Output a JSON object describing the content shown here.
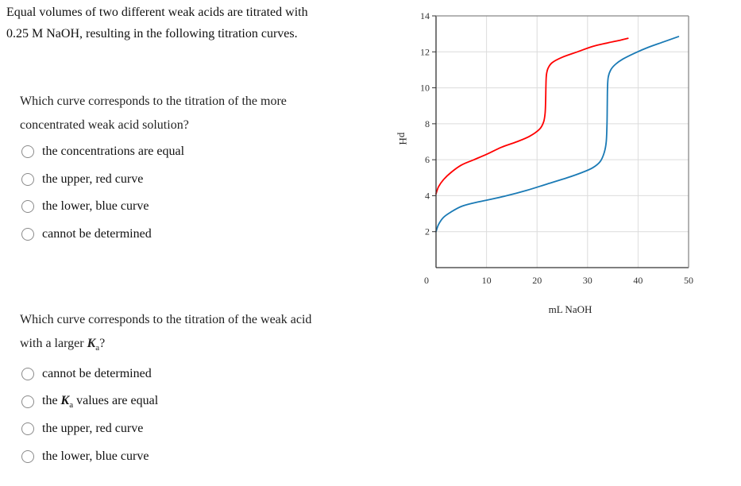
{
  "intro": {
    "line1": "Equal volumes of two different weak acids are titrated with",
    "line2": "0.25 M NaOH, resulting in the following titration curves."
  },
  "questions": [
    {
      "line1": "Which curve corresponds to the titration of the more",
      "line2": "concentrated weak acid solution?",
      "options": [
        {
          "label": "the concentrations are equal",
          "selected": false
        },
        {
          "label": "the upper, red curve",
          "selected": false
        },
        {
          "label": "the lower, blue curve",
          "selected": false
        },
        {
          "label": "cannot be determined",
          "selected": false
        }
      ]
    },
    {
      "line1": "Which curve corresponds to the titration of the weak acid",
      "line2_prefix": "with a larger ",
      "line2_K": "K",
      "line2_sub": "a",
      "line2_suffix": "?",
      "options": [
        {
          "label": "cannot be determined",
          "selected": false
        },
        {
          "label_prefix": "the ",
          "label_K": "K",
          "label_sub": "a",
          "label_suffix": " values are equal",
          "selected": false
        },
        {
          "label": "the upper, red curve",
          "selected": false
        },
        {
          "label": "the lower, blue curve",
          "selected": false
        }
      ]
    }
  ],
  "chart_data": {
    "type": "line",
    "title": "",
    "xlabel": "mL NaOH",
    "ylabel": "pH",
    "xlim": [
      0,
      50
    ],
    "ylim": [
      0,
      14
    ],
    "xticks": [
      0,
      10,
      20,
      30,
      40,
      50
    ],
    "yticks": [
      2,
      4,
      6,
      8,
      10,
      12,
      14
    ],
    "grid": true,
    "legend": "none",
    "series": [
      {
        "name": "upper, red curve",
        "color": "#ff0000",
        "x": [
          0,
          0.5,
          1.5,
          3,
          5,
          7.5,
          10,
          13,
          16,
          18.5,
          20.5,
          21.3,
          21.6,
          21.7,
          21.75,
          21.8,
          21.9,
          22.2,
          23,
          25,
          28,
          31,
          34,
          36.5,
          38
        ],
        "y": [
          4.1,
          4.5,
          4.9,
          5.3,
          5.7,
          6.0,
          6.3,
          6.7,
          7.0,
          7.3,
          7.7,
          8.1,
          8.6,
          9.3,
          10.0,
          10.5,
          10.8,
          11.1,
          11.4,
          11.7,
          12.0,
          12.3,
          12.5,
          12.65,
          12.75
        ]
      },
      {
        "name": "lower, blue curve",
        "color": "#1a7ab5",
        "x": [
          0,
          0.5,
          1.5,
          3,
          5,
          7.5,
          10,
          14,
          18,
          22,
          26,
          29,
          31,
          32.5,
          33.3,
          33.7,
          33.85,
          33.9,
          33.95,
          34.1,
          34.6,
          35.5,
          37,
          39.5,
          42,
          45,
          48
        ],
        "y": [
          2.0,
          2.4,
          2.8,
          3.1,
          3.4,
          3.6,
          3.75,
          4.0,
          4.3,
          4.65,
          5.0,
          5.3,
          5.55,
          5.9,
          6.4,
          7.0,
          8.0,
          9.0,
          10.0,
          10.6,
          11.0,
          11.3,
          11.6,
          11.95,
          12.25,
          12.55,
          12.85
        ]
      }
    ]
  }
}
